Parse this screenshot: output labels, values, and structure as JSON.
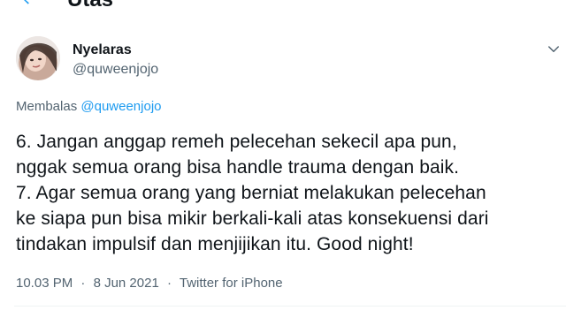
{
  "header": {
    "title": "Utas",
    "back_icon": "arrow-left-icon"
  },
  "colors": {
    "accent": "#1d9bf0",
    "text_primary": "#0f1419",
    "text_secondary": "#536471",
    "divider": "#eff3f4"
  },
  "tweet": {
    "author": {
      "name": "Nyelaras",
      "handle": "@quweenjojo",
      "avatar_icon": "profile-avatar"
    },
    "more_icon": "chevron-down-icon",
    "reply_to": {
      "prefix": "Membalas",
      "mention": "@quweenjojo"
    },
    "text_lines": [
      "6. Jangan anggap remeh pelecehan sekecil apa pun,",
      "nggak semua orang bisa handle trauma dengan baik.",
      "7. Agar semua orang yang berniat melakukan pelecehan",
      "ke siapa pun bisa mikir berkali-kali atas konsekuensi dari",
      "tindakan impulsif dan menjijikan itu. Good night!"
    ],
    "time": "10.03 PM",
    "date": "8 Jun 2021",
    "separator": "·",
    "source": "Twitter for iPhone"
  }
}
